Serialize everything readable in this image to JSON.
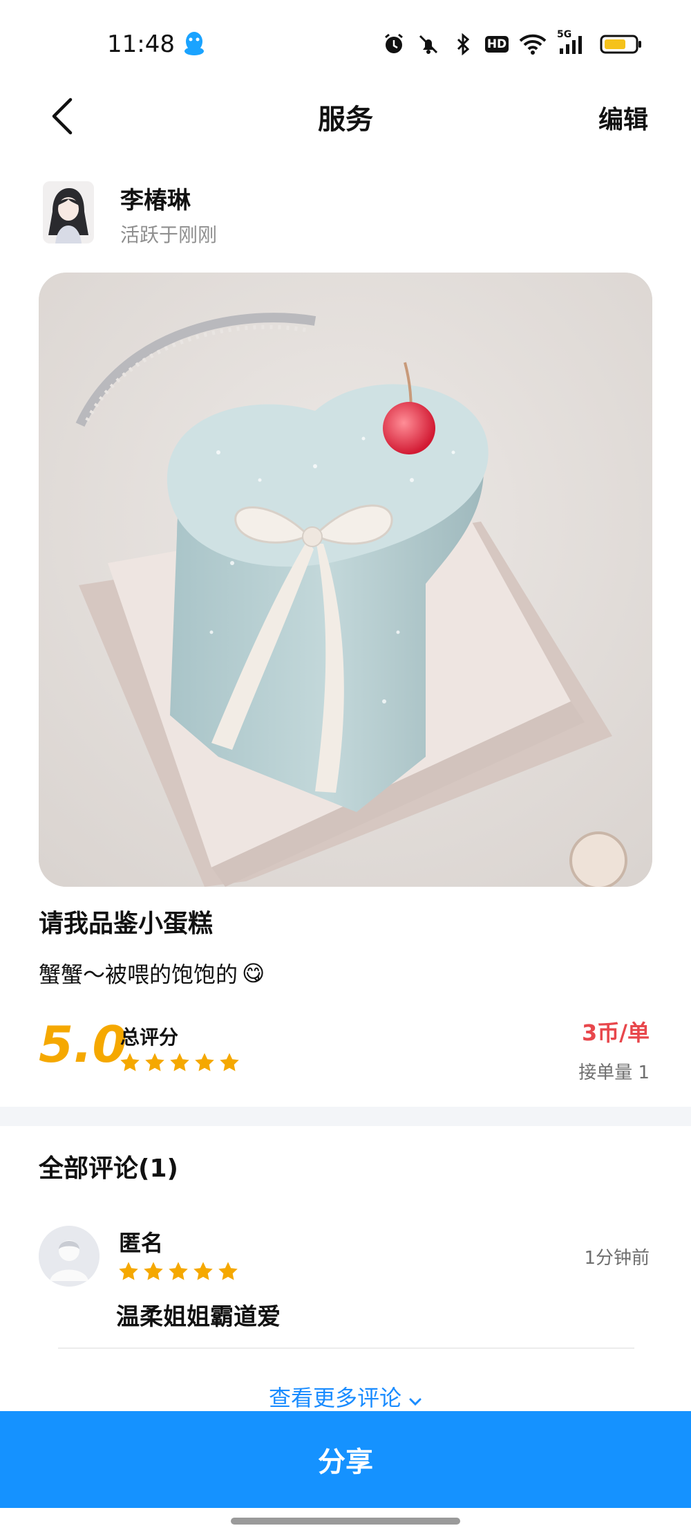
{
  "status_bar": {
    "time": "11:48",
    "battery_color": "#f5c21a",
    "icons": [
      "qq-icon",
      "alarm-icon",
      "mute-icon",
      "bluetooth-icon",
      "hd-icon",
      "wifi-icon",
      "signal-5g-icon",
      "battery-icon"
    ],
    "hd_label": "HD",
    "network_label": "5G"
  },
  "nav": {
    "title": "服务",
    "edit_label": "编辑"
  },
  "seller": {
    "name": "李椿琳",
    "active_status": "活跃于刚刚"
  },
  "service": {
    "title": "请我品鉴小蛋糕",
    "description": "蟹蟹～被喂的饱饱的",
    "emoji": "😋",
    "score": "5.0",
    "score_label": "总评分",
    "stars": 5,
    "price": "3币/单",
    "order_count": "接单量 1",
    "accent_color": "#f5a800",
    "price_color": "#e8474c"
  },
  "comments": {
    "header": "全部评论(1)",
    "items": [
      {
        "author": "匿名",
        "stars": 5,
        "time": "1分钟前",
        "text": "温柔姐姐霸道爱"
      }
    ],
    "more_label": "查看更多评论"
  },
  "share": {
    "label": "分享",
    "color": "#1592ff"
  }
}
